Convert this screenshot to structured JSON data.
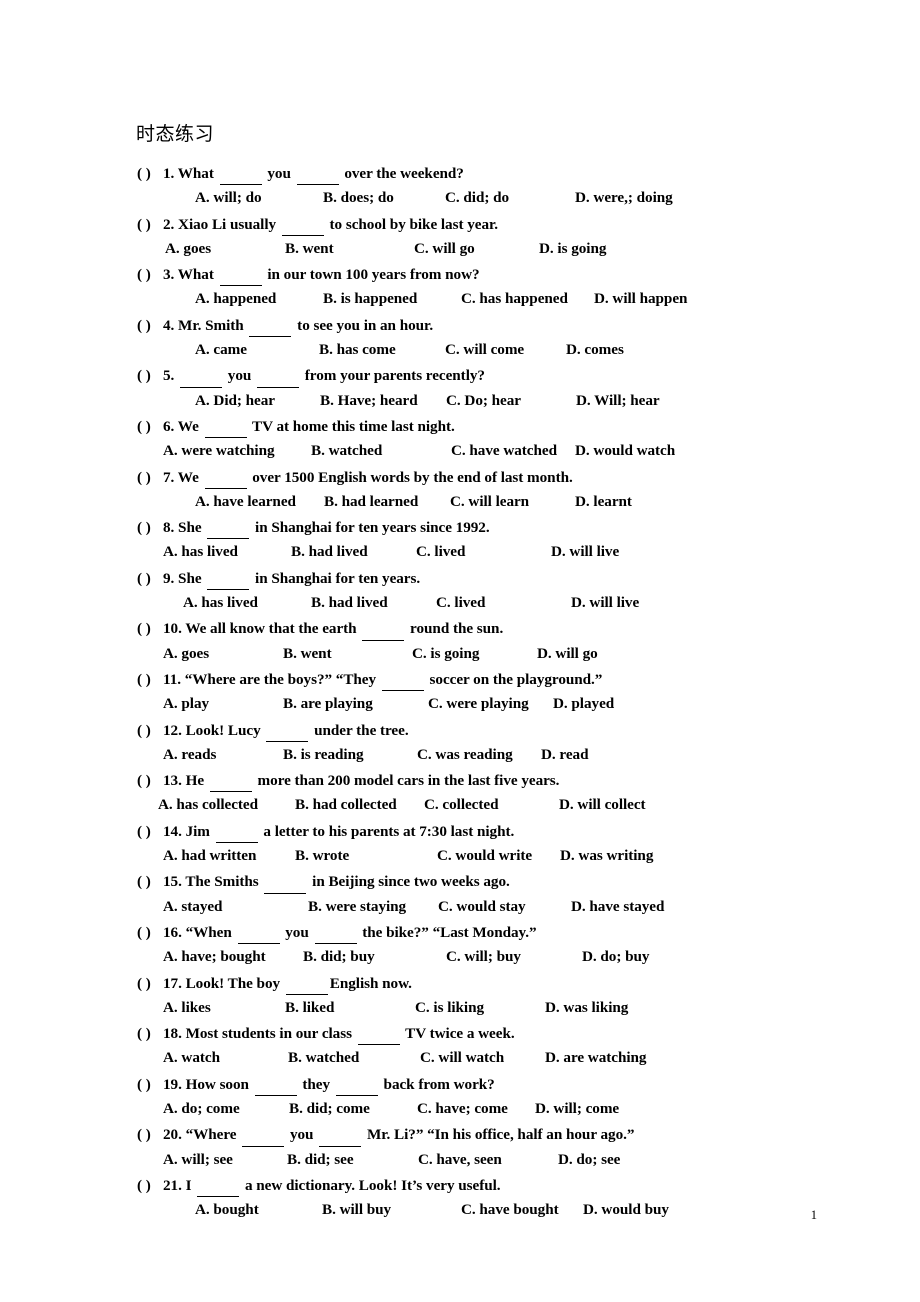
{
  "document": {
    "title": "时态练习",
    "page_number": "1"
  },
  "marker": "(    )",
  "questions": [
    {
      "number": "1.",
      "stem_parts": [
        " What ",
        "BLANK",
        " you ",
        "BLANK",
        " over the weekend?"
      ],
      "options_indent": 58,
      "options": [
        {
          "label": "A. will; do",
          "width": 128
        },
        {
          "label": "B. does; do",
          "width": 122
        },
        {
          "label": "C. did; do",
          "width": 130
        },
        {
          "label": "D. were,; doing",
          "width": 0
        }
      ]
    },
    {
      "number": "2.",
      "stem_parts": [
        " Xiao Li usually ",
        "BLANK",
        " to school by bike last year."
      ],
      "options_indent": 28,
      "options": [
        {
          "label": "A. goes",
          "width": 120
        },
        {
          "label": "B. went",
          "width": 129
        },
        {
          "label": "C. will go",
          "width": 125
        },
        {
          "label": "D. is going",
          "width": 0
        }
      ]
    },
    {
      "number": "3.",
      "stem_parts": [
        " What ",
        "BLANK",
        " in our town 100 years from now?"
      ],
      "options_indent": 58,
      "options": [
        {
          "label": "A. happened",
          "width": 128
        },
        {
          "label": "B. is happened",
          "width": 138
        },
        {
          "label": "C. has happened",
          "width": 133
        },
        {
          "label": "D. will happen",
          "width": 0
        }
      ]
    },
    {
      "number": "4.",
      "stem_parts": [
        " Mr. Smith ",
        "BLANK",
        " to see you in an hour."
      ],
      "options_indent": 58,
      "options": [
        {
          "label": "A. came",
          "width": 124
        },
        {
          "label": "B. has come",
          "width": 126
        },
        {
          "label": "C. will come",
          "width": 121
        },
        {
          "label": "D. comes",
          "width": 0
        }
      ]
    },
    {
      "number": "5.",
      "stem_parts": [
        " ",
        "BLANK",
        " you ",
        "BLANK",
        " from your parents recently?"
      ],
      "options_indent": 58,
      "options": [
        {
          "label": "A. Did; hear",
          "width": 125
        },
        {
          "label": "B. Have; heard",
          "width": 126
        },
        {
          "label": "C. Do; hear",
          "width": 130
        },
        {
          "label": "D. Will; hear",
          "width": 0
        }
      ]
    },
    {
      "number": "6.",
      "stem_parts": [
        " We ",
        "BLANK",
        " TV at home this time last night."
      ],
      "options_indent": 26,
      "options": [
        {
          "label": "A. were watching",
          "width": 148
        },
        {
          "label": "B. watched",
          "width": 140
        },
        {
          "label": "C. have watched",
          "width": 124
        },
        {
          "label": "D. would watch",
          "width": 0
        }
      ]
    },
    {
      "number": "7.",
      "stem_parts": [
        " We ",
        "BLANK",
        " over 1500 English words by the end of last month."
      ],
      "options_indent": 58,
      "options": [
        {
          "label": "A. have learned",
          "width": 129
        },
        {
          "label": "B. had learned",
          "width": 126
        },
        {
          "label": "C. will learn",
          "width": 125
        },
        {
          "label": "D. learnt",
          "width": 0
        }
      ]
    },
    {
      "number": "8.",
      "stem_parts": [
        " She ",
        "BLANK",
        " in Shanghai for ten years since 1992."
      ],
      "options_indent": 26,
      "options": [
        {
          "label": "A. has lived",
          "width": 128
        },
        {
          "label": "B. had lived",
          "width": 125
        },
        {
          "label": "C. lived",
          "width": 135
        },
        {
          "label": "D. will live",
          "width": 0
        }
      ]
    },
    {
      "number": "9.",
      "stem_parts": [
        " She ",
        "BLANK",
        " in Shanghai for ten years."
      ],
      "options_indent": 46,
      "options": [
        {
          "label": "A. has lived",
          "width": 128
        },
        {
          "label": "B. had lived",
          "width": 125
        },
        {
          "label": "C. lived",
          "width": 135
        },
        {
          "label": "D. will live",
          "width": 0
        }
      ]
    },
    {
      "number": "10.",
      "stem_parts": [
        " We all know that the earth ",
        "BLANK",
        " round the sun."
      ],
      "options_indent": 26,
      "options": [
        {
          "label": "A. goes",
          "width": 120
        },
        {
          "label": "B. went",
          "width": 129
        },
        {
          "label": "C. is going",
          "width": 125
        },
        {
          "label": "D. will go",
          "width": 0
        }
      ]
    },
    {
      "number": "11.",
      "stem_parts": [
        " “Where are the boys?”   “They ",
        "BLANK",
        " soccer on the playground.”"
      ],
      "options_indent": 26,
      "options": [
        {
          "label": "A. play",
          "width": 120
        },
        {
          "label": "B. are playing",
          "width": 145
        },
        {
          "label": "C. were playing",
          "width": 125
        },
        {
          "label": "D. played",
          "width": 0
        }
      ]
    },
    {
      "number": "12.",
      "stem_parts": [
        " Look! Lucy ",
        "BLANK",
        " under the tree."
      ],
      "options_indent": 26,
      "options": [
        {
          "label": "A. reads",
          "width": 120
        },
        {
          "label": "B. is reading",
          "width": 134
        },
        {
          "label": "C. was reading",
          "width": 124
        },
        {
          "label": "D. read",
          "width": 0
        }
      ]
    },
    {
      "number": "13.",
      "stem_parts": [
        " He ",
        "BLANK",
        " more than 200 model cars in the last five years."
      ],
      "options_indent": 21,
      "options": [
        {
          "label": "A. has collected",
          "width": 137
        },
        {
          "label": "B. had collected",
          "width": 129
        },
        {
          "label": "C. collected",
          "width": 135
        },
        {
          "label": "D. will collect",
          "width": 0
        }
      ]
    },
    {
      "number": "14.",
      "stem_parts": [
        " Jim ",
        "BLANK",
        " a letter to his parents at 7:30 last night."
      ],
      "options_indent": 26,
      "options": [
        {
          "label": "A. had written",
          "width": 132
        },
        {
          "label": "B. wrote",
          "width": 142
        },
        {
          "label": "C. would write",
          "width": 123
        },
        {
          "label": "D. was writing",
          "width": 0
        }
      ]
    },
    {
      "number": "15.",
      "stem_parts": [
        " The Smiths ",
        "BLANK",
        " in Beijing since two weeks ago."
      ],
      "options_indent": 26,
      "options": [
        {
          "label": "A. stayed",
          "width": 145
        },
        {
          "label": "B. were staying",
          "width": 130
        },
        {
          "label": "C. would stay",
          "width": 133
        },
        {
          "label": "D. have stayed",
          "width": 0
        }
      ]
    },
    {
      "number": "16.",
      "stem_parts": [
        " “When ",
        "BLANK",
        " you ",
        "BLANK",
        " the bike?”  “Last Monday.”"
      ],
      "options_indent": 26,
      "options": [
        {
          "label": "A. have; bought",
          "width": 140
        },
        {
          "label": "B. did; buy",
          "width": 143
        },
        {
          "label": "C. will; buy",
          "width": 136
        },
        {
          "label": "D. do; buy",
          "width": 0
        }
      ]
    },
    {
      "number": "17.",
      "stem_parts": [
        " Look! The boy ",
        "BLANK",
        "English now."
      ],
      "options_indent": 26,
      "options": [
        {
          "label": "A. likes",
          "width": 122
        },
        {
          "label": "B. liked",
          "width": 130
        },
        {
          "label": "C. is liking",
          "width": 130
        },
        {
          "label": "D. was liking",
          "width": 0
        }
      ]
    },
    {
      "number": "18.",
      "stem_parts": [
        " Most students in our class ",
        "BLANK",
        " TV twice a week."
      ],
      "options_indent": 26,
      "options": [
        {
          "label": "A. watch",
          "width": 125
        },
        {
          "label": "B. watched",
          "width": 132
        },
        {
          "label": "C. will watch",
          "width": 125
        },
        {
          "label": "D. are watching",
          "width": 0
        }
      ]
    },
    {
      "number": "19.",
      "stem_parts": [
        " How soon ",
        "BLANK",
        " they ",
        "BLANK",
        " back from work?"
      ],
      "options_indent": 26,
      "options": [
        {
          "label": "A. do; come",
          "width": 126
        },
        {
          "label": "B. did; come",
          "width": 128
        },
        {
          "label": "C. have; come",
          "width": 118
        },
        {
          "label": "D. will; come",
          "width": 0
        }
      ]
    },
    {
      "number": "20.",
      "stem_parts": [
        " “Where ",
        "BLANK",
        " you ",
        "BLANK",
        " Mr. Li?”  “In his office, half an hour ago.”"
      ],
      "options_indent": 26,
      "options": [
        {
          "label": "A. will; see",
          "width": 124
        },
        {
          "label": "B. did; see",
          "width": 131
        },
        {
          "label": "C. have, seen",
          "width": 140
        },
        {
          "label": "D. do; see",
          "width": 0
        }
      ]
    },
    {
      "number": "21.",
      "stem_parts": [
        " I ",
        "BLANK",
        " a new dictionary. Look! It’s very useful."
      ],
      "options_indent": 58,
      "options": [
        {
          "label": "A. bought",
          "width": 127
        },
        {
          "label": "B. will buy",
          "width": 139
        },
        {
          "label": "C. have bought",
          "width": 122
        },
        {
          "label": "D. would buy",
          "width": 0
        }
      ]
    }
  ]
}
